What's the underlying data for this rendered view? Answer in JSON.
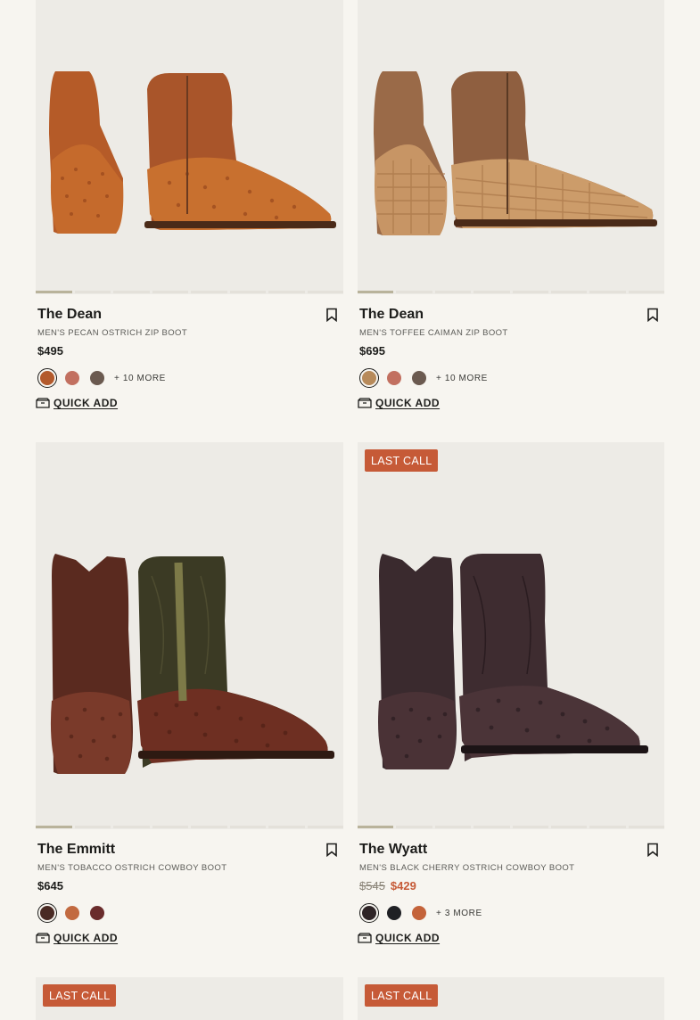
{
  "products": [
    {
      "name": "The Dean",
      "subtitle": "MEN'S PECAN OSTRICH ZIP BOOT",
      "price": "$495",
      "more": "+ 10 MORE",
      "quick_add": "QUICK ADD",
      "swatch_colors": [
        "#b35a2c",
        "#c27060",
        "#6b5a50"
      ]
    },
    {
      "name": "The Dean",
      "subtitle": "MEN'S TOFFEE CAIMAN ZIP BOOT",
      "price": "$695",
      "more": "+ 10 MORE",
      "quick_add": "QUICK ADD",
      "swatch_colors": [
        "#b78a5a",
        "#c27060",
        "#6b5a50"
      ]
    },
    {
      "badge": "",
      "name": "The Emmitt",
      "subtitle": "MEN'S TOBACCO OSTRICH COWBOY BOOT",
      "price": "$645",
      "quick_add": "QUICK ADD",
      "swatch_colors": [
        "#4a2a24",
        "#c26a40",
        "#6a2c2c"
      ]
    },
    {
      "badge": "LAST CALL",
      "name": "The Wyatt",
      "subtitle": "MEN'S BLACK CHERRY OSTRICH COWBOY BOOT",
      "original_price": "$545",
      "sale_price": "$429",
      "more": "+ 3 MORE",
      "quick_add": "QUICK ADD",
      "swatch_colors": [
        "#2e2426",
        "#1f2024",
        "#c4633a"
      ]
    },
    {
      "badge": "LAST CALL"
    },
    {
      "badge": "LAST CALL"
    }
  ],
  "icons": {
    "bookmark": "bookmark-icon",
    "quick_add": "shoebox-icon"
  },
  "colors": {
    "badge": "#c65a37",
    "background": "#f7f5f0",
    "image_bg": "#edebe6"
  }
}
